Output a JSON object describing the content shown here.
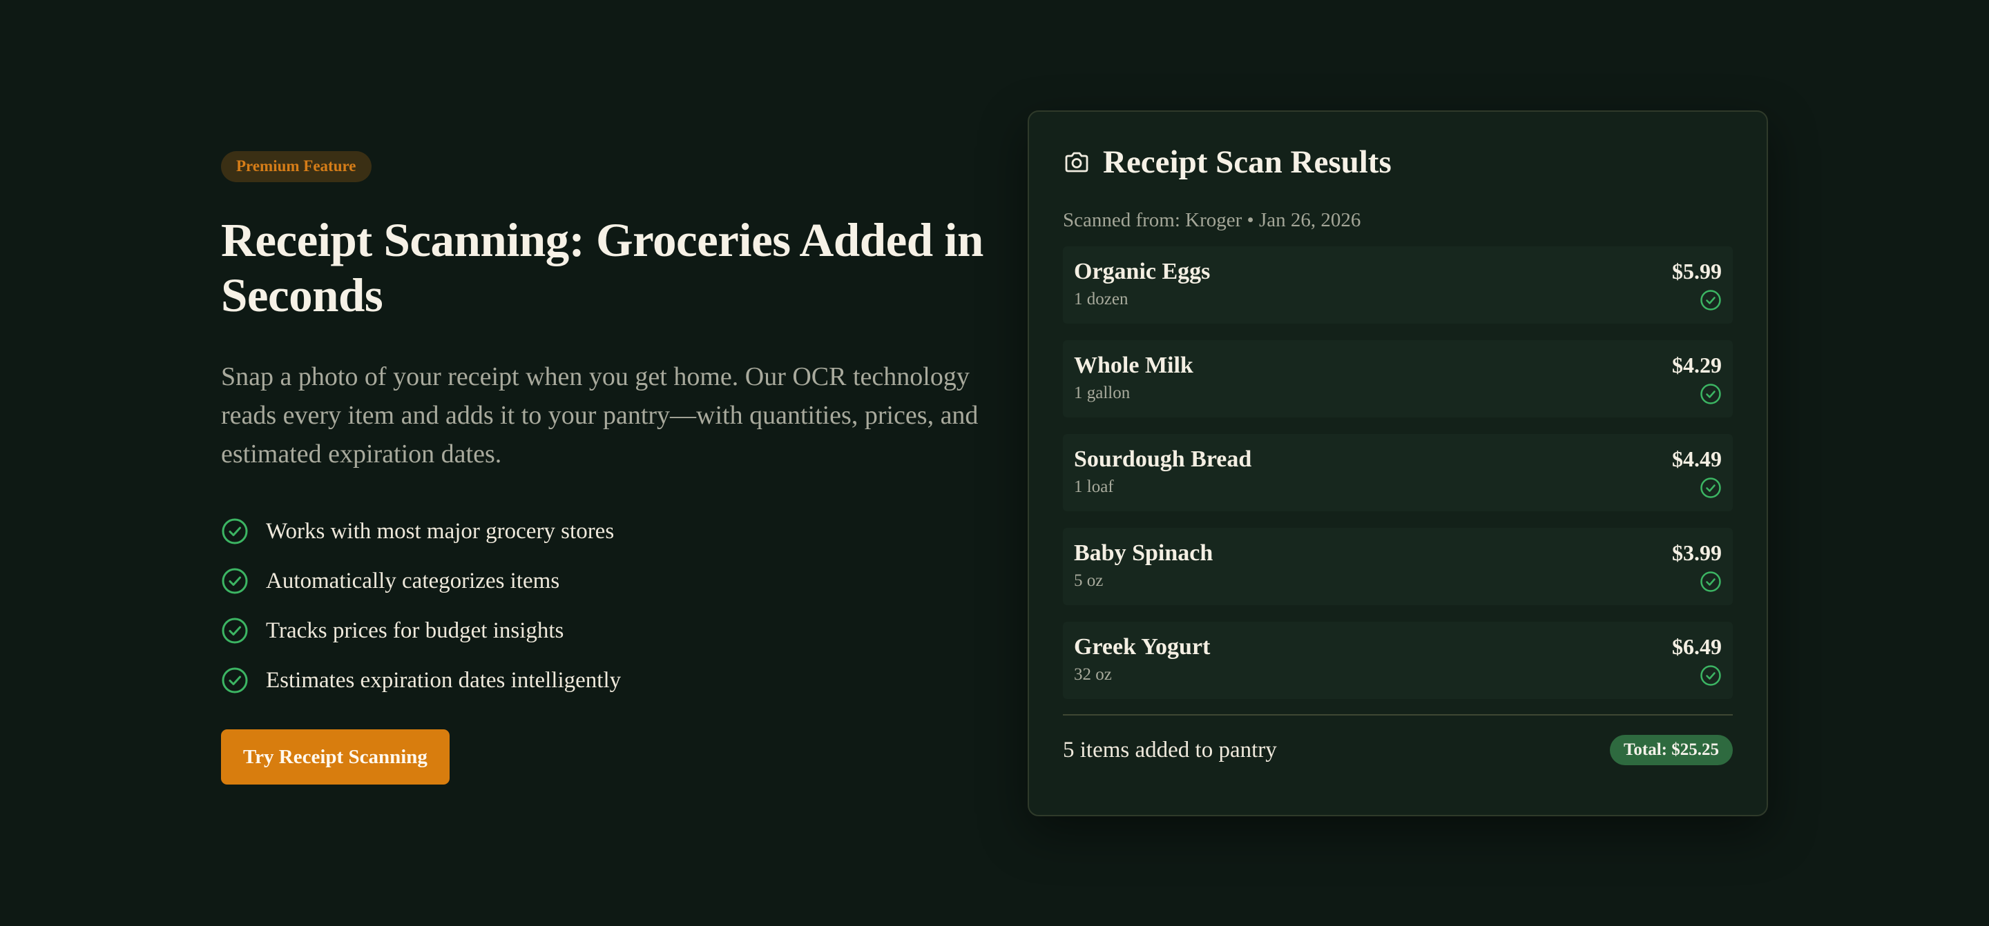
{
  "hero": {
    "badge": "Premium Feature",
    "headline": "Receipt Scanning: Groceries Added in Seconds",
    "lede": "Snap a photo of your receipt when you get home. Our OCR technology reads every item and adds it to your pantry—with quantities, prices, and estimated expiration dates.",
    "features": [
      "Works with most major grocery stores",
      "Automatically categorizes items",
      "Tracks prices for budget insights",
      "Estimates expiration dates intelligently"
    ],
    "cta_label": "Try Receipt Scanning",
    "icons": {
      "feature": "check-circle-icon"
    }
  },
  "card": {
    "title": "Receipt Scan Results",
    "icon": "camera-icon",
    "scan_source": "Scanned from: Kroger • Jan 26, 2026",
    "items": [
      {
        "name": "Organic Eggs",
        "qty": "1 dozen",
        "price": "$5.99"
      },
      {
        "name": "Whole Milk",
        "qty": "1 gallon",
        "price": "$4.29"
      },
      {
        "name": "Sourdough Bread",
        "qty": "1 loaf",
        "price": "$4.49"
      },
      {
        "name": "Baby Spinach",
        "qty": "5 oz",
        "price": "$3.99"
      },
      {
        "name": "Greek Yogurt",
        "qty": "32 oz",
        "price": "$6.49"
      }
    ],
    "footer_text": "5 items added to pantry",
    "total": "Total: $25.25"
  },
  "colors": {
    "background": "#0e1914",
    "accent_orange": "#d87d0e",
    "success_green": "#3cb563",
    "total_badge": "#2e6a3f"
  }
}
